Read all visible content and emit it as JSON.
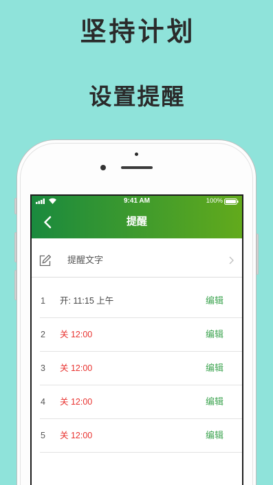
{
  "colors": {
    "background": "#8fe3da",
    "header_gradient_start": "#1a8a3e",
    "header_gradient_end": "#62aa1c",
    "off_text": "#e8322f",
    "edit_text": "#3fa552"
  },
  "promo": {
    "title": "坚持计划",
    "subtitle": "设置提醒"
  },
  "status_bar": {
    "time": "9:41 AM",
    "battery": "100%",
    "icons": [
      "signal-icon",
      "wifi-icon",
      "battery-icon"
    ]
  },
  "nav": {
    "title": "提醒",
    "back_icon": "back-chevron-icon"
  },
  "reminder_text_row": {
    "label": "提醒文字",
    "icon": "pencil-icon",
    "chevron_icon": "chevron-right-icon"
  },
  "reminders": [
    {
      "index": "1",
      "status": "开: 11:15 上午",
      "enabled": true,
      "edit_label": "编辑"
    },
    {
      "index": "2",
      "status": "关 12:00",
      "enabled": false,
      "edit_label": "编辑"
    },
    {
      "index": "3",
      "status": "关 12:00",
      "enabled": false,
      "edit_label": "编辑"
    },
    {
      "index": "4",
      "status": "关 12:00",
      "enabled": false,
      "edit_label": "编辑"
    },
    {
      "index": "5",
      "status": "关 12:00",
      "enabled": false,
      "edit_label": "编辑"
    }
  ]
}
